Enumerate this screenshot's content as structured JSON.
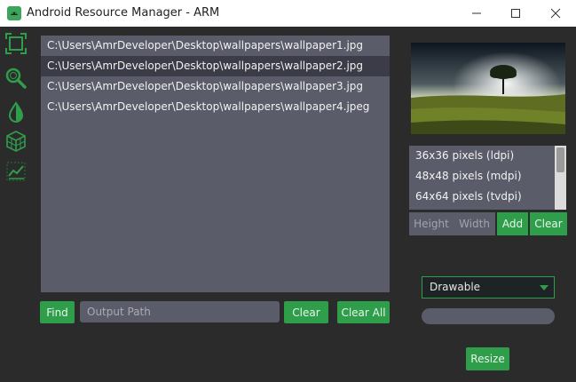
{
  "window": {
    "title": "Android Resource Manager - ARM",
    "icon": "android-app-icon",
    "controls": [
      "minimize-icon",
      "maximize-icon",
      "close-icon"
    ]
  },
  "sidebar": {
    "icons": [
      "crop-icon",
      "magnifier-icon",
      "drop-icon",
      "cube-icon",
      "chart-icon"
    ]
  },
  "files": [
    {
      "path": "C:\\Users\\AmrDeveloper\\Desktop\\wallpapers\\wallpaper1.jpg",
      "selected": false
    },
    {
      "path": "C:\\Users\\AmrDeveloper\\Desktop\\wallpapers\\wallpaper2.jpg",
      "selected": true
    },
    {
      "path": "C:\\Users\\AmrDeveloper\\Desktop\\wallpapers\\wallpaper3.jpg",
      "selected": false
    },
    {
      "path": "C:\\Users\\AmrDeveloper\\Desktop\\wallpapers\\wallpaper4.jpeg",
      "selected": false
    }
  ],
  "bottom_bar": {
    "find_label": "Find",
    "output_placeholder": "Output Path",
    "clear_label": "Clear",
    "clear_all_label": "Clear All"
  },
  "sizes": {
    "items": [
      "36x36 pixels (ldpi)",
      "48x48 pixels (mdpi)",
      "64x64 pixels (tvdpi)"
    ],
    "height_placeholder": "Height",
    "width_placeholder": "Width",
    "add_label": "Add",
    "clear_label": "Clear"
  },
  "resource_type": {
    "selected": "Drawable"
  },
  "progress": {
    "value": 0
  },
  "resize_label": "Resize",
  "colors": {
    "accent": "#2f9e4b",
    "panel": "#5b5c69",
    "background": "#2b2b2b"
  }
}
